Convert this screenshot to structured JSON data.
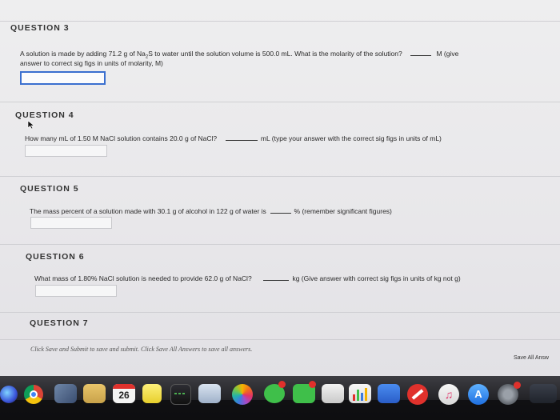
{
  "q3": {
    "title": "QUESTION 3",
    "line1": "A solution is made by adding 71.2 g of Na",
    "sub": "2",
    "line1b": "S to water until the solution volume is 500.0 mL.  What is the molarity of the solution?",
    "unit": "M  (give",
    "line2": "answer to correct sig figs in units of molarity, M)"
  },
  "q4": {
    "title": "QUESTION 4",
    "text": "How many mL of 1.50 M NaCl solution contains 20.0 g of NaCl?",
    "unit": "mL (type your answer with the correct sig figs in units of mL)"
  },
  "q5": {
    "title": "QUESTION 5",
    "text": "The mass percent of a solution made with 30.1 g of alcohol in 122 g of water is",
    "unit": "%  (remember significant figures)"
  },
  "q6": {
    "title": "QUESTION 6",
    "text": "What  mass of 1.80% NaCl solution is needed to provide 62.0 g of NaCl?",
    "unit": "kg (Give answer with correct sig figs in units of kg not g)"
  },
  "q7": {
    "title": "QUESTION 7"
  },
  "footer": {
    "note": "Click Save and Submit to save and submit. Click Save All Answers to save all answers.",
    "save_all": "Save All Answ"
  },
  "dock": {
    "calendar_day": "26",
    "icons": [
      "siri-icon",
      "chrome-icon",
      "preview-icon",
      "notes-icon",
      "calendar-icon",
      "stickies-icon",
      "grapher-icon",
      "photo-booth-icon",
      "photos-icon",
      "messages-icon",
      "facetime-icon",
      "mail-icon",
      "numbers-icon",
      "keynote-icon",
      "news-icon",
      "music-icon",
      "app-store-icon",
      "system-preferences-icon"
    ],
    "colors": {
      "accent": "#3b6fcf",
      "badge": "#e0312c"
    }
  }
}
